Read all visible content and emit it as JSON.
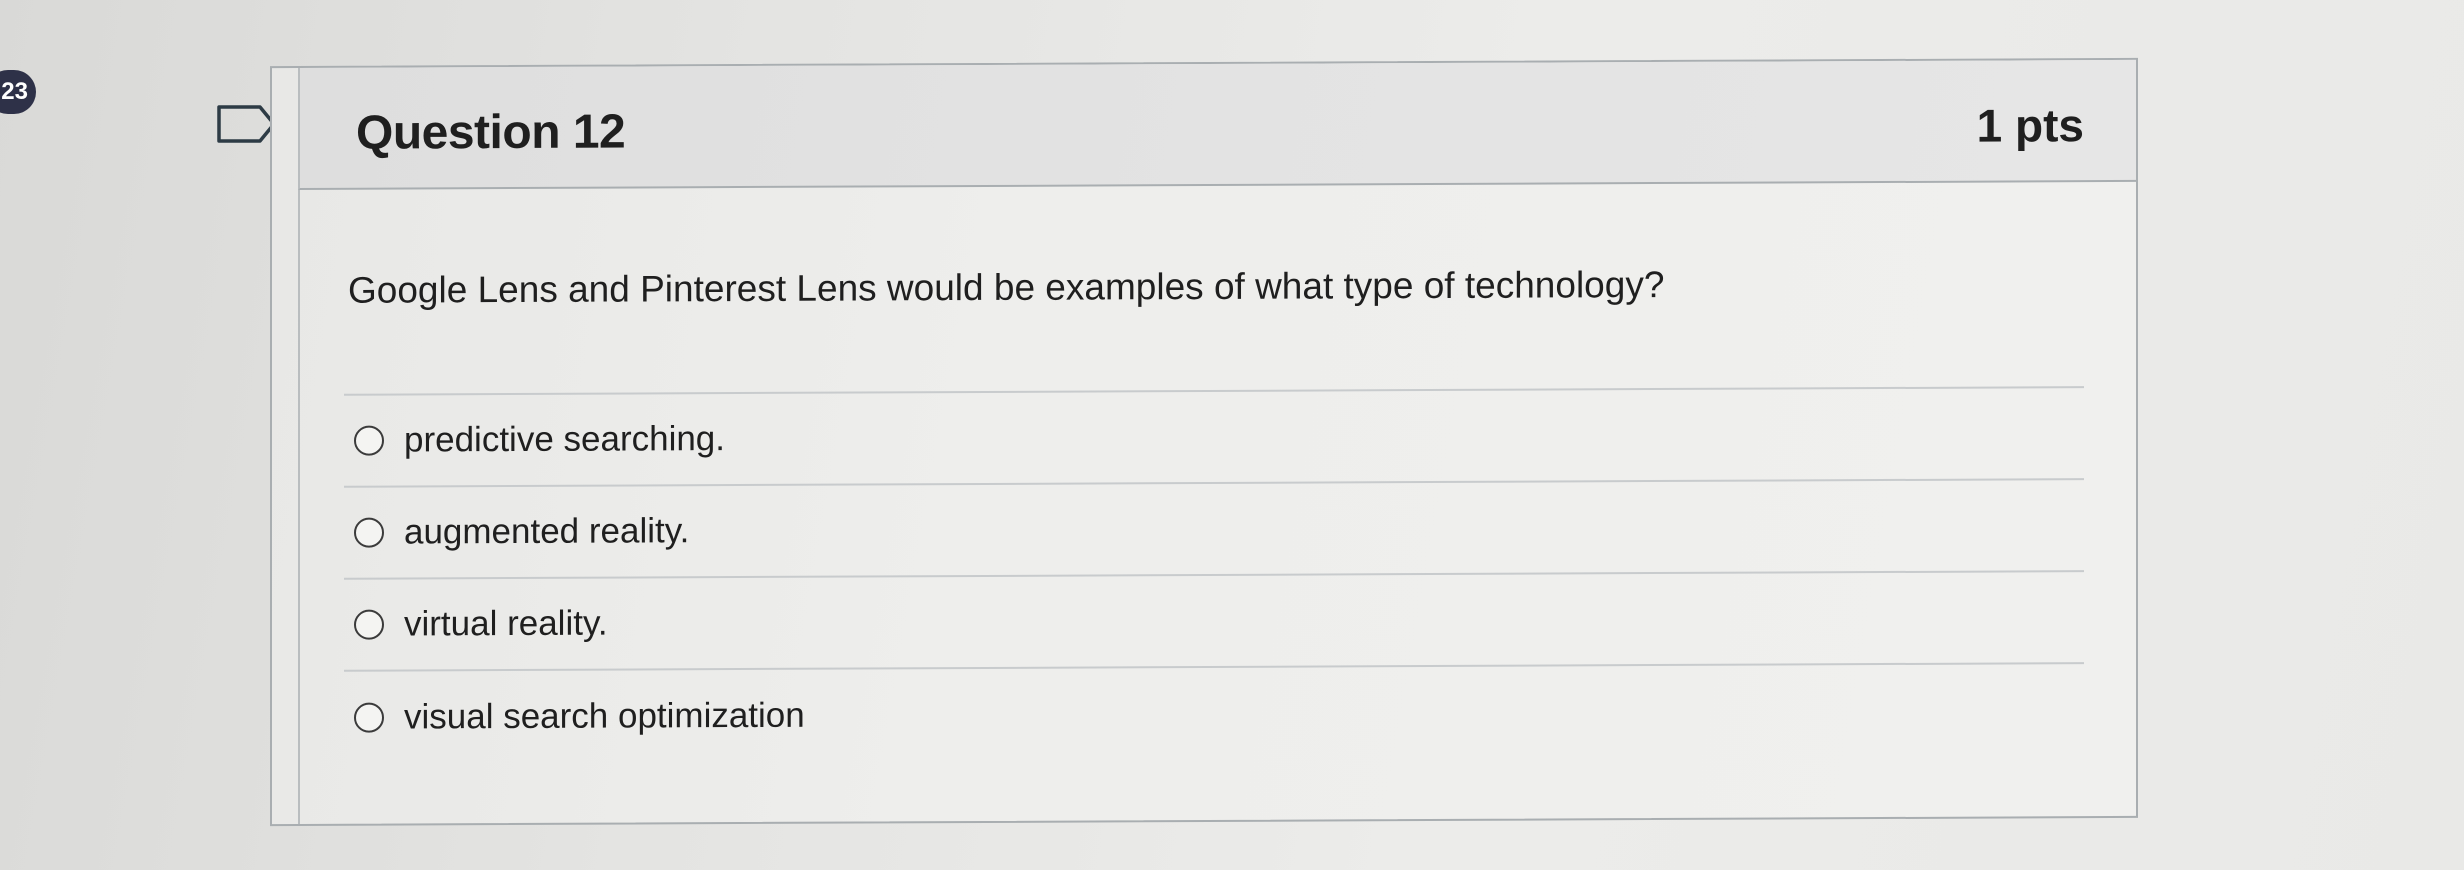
{
  "page_badge": "23",
  "question": {
    "title": "Question 12",
    "points": "1 pts",
    "text": "Google Lens and Pinterest Lens would be examples of what type of technology?",
    "answers": [
      {
        "label": "predictive searching."
      },
      {
        "label": "augmented reality."
      },
      {
        "label": "virtual reality."
      },
      {
        "label": "visual search optimization"
      }
    ]
  },
  "icons": {
    "flag": "flag-question-icon",
    "radio": "radio-unselected-icon"
  },
  "colors": {
    "badge": "#2e3148",
    "border": "#a9aeb1",
    "text": "#1f1f1f"
  }
}
